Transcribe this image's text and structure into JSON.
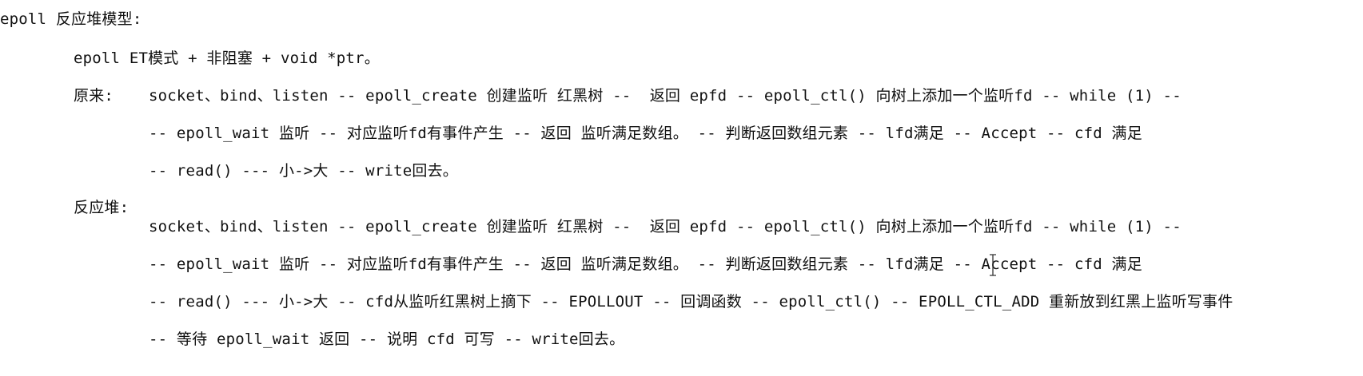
{
  "document": {
    "title": "epoll 反应堆模型:",
    "subtitle": "epoll ET模式 + 非阻塞 + void *ptr。",
    "original": {
      "label": "原来:",
      "lines": [
        "socket、bind、listen -- epoll_create 创建监听 红黑树 --  返回 epfd -- epoll_ctl() 向树上添加一个监听fd -- while (1) --",
        "-- epoll_wait 监听 -- 对应监听fd有事件产生 -- 返回 监听满足数组。 -- 判断返回数组元素 -- lfd满足 -- Accept -- cfd 满足",
        "-- read() --- 小->大 -- write回去。"
      ]
    },
    "reactor": {
      "label": "反应堆:",
      "lines": [
        "socket、bind、listen -- epoll_create 创建监听 红黑树 --  返回 epfd -- epoll_ctl() 向树上添加一个监听fd -- while (1) --",
        "-- epoll_wait 监听 -- 对应监听fd有事件产生 -- 返回 监听满足数组。 -- 判断返回数组元素 -- lfd满足 -- Accept -- cfd 满足",
        "-- read() --- 小->大 -- cfd从监听红黑树上摘下 -- EPOLLOUT -- 回调函数 -- epoll_ctl() -- EPOLL_CTL_ADD 重新放到红黑上监听写事件",
        "-- 等待 epoll_wait 返回 -- 说明 cfd 可写 -- write回去。"
      ]
    }
  },
  "cursor": {
    "icon": "ibeam-cursor-icon"
  }
}
